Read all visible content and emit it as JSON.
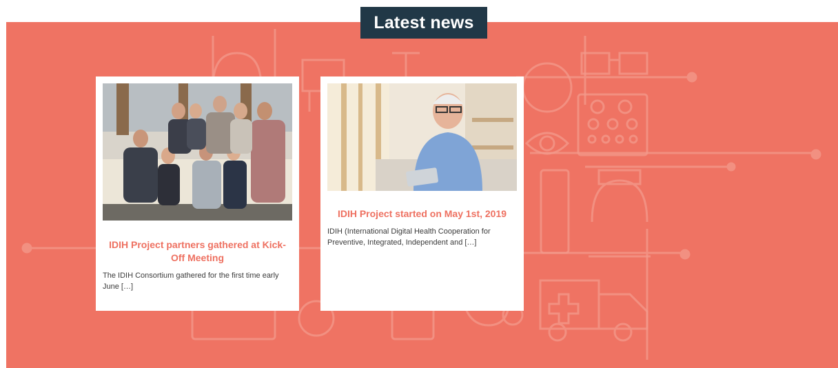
{
  "section": {
    "title": "Latest news"
  },
  "colors": {
    "banner": "#ef7363",
    "title_bg": "#213847",
    "accent": "#ee7060"
  },
  "background_icons": [
    "doctor-icon",
    "microscope-icon",
    "glasses-icon",
    "magnifier-icon",
    "eye-chart-icon",
    "eye-icon",
    "thermometer-icon",
    "nurse-icon",
    "ambulance-icon",
    "stethoscope-icon",
    "scale-icon"
  ],
  "posts": [
    {
      "title": "IDIH Project partners gathered at Kick-Off Meeting",
      "excerpt": "The IDIH Consortium gathered for the first time early June […]",
      "image": "group-photo"
    },
    {
      "title": "IDIH Project started on May 1st, 2019",
      "excerpt": "IDIH (International Digital Health Cooperation for Preventive, Integrated, Independent and […]",
      "image": "senior-with-tablet-photo"
    }
  ]
}
